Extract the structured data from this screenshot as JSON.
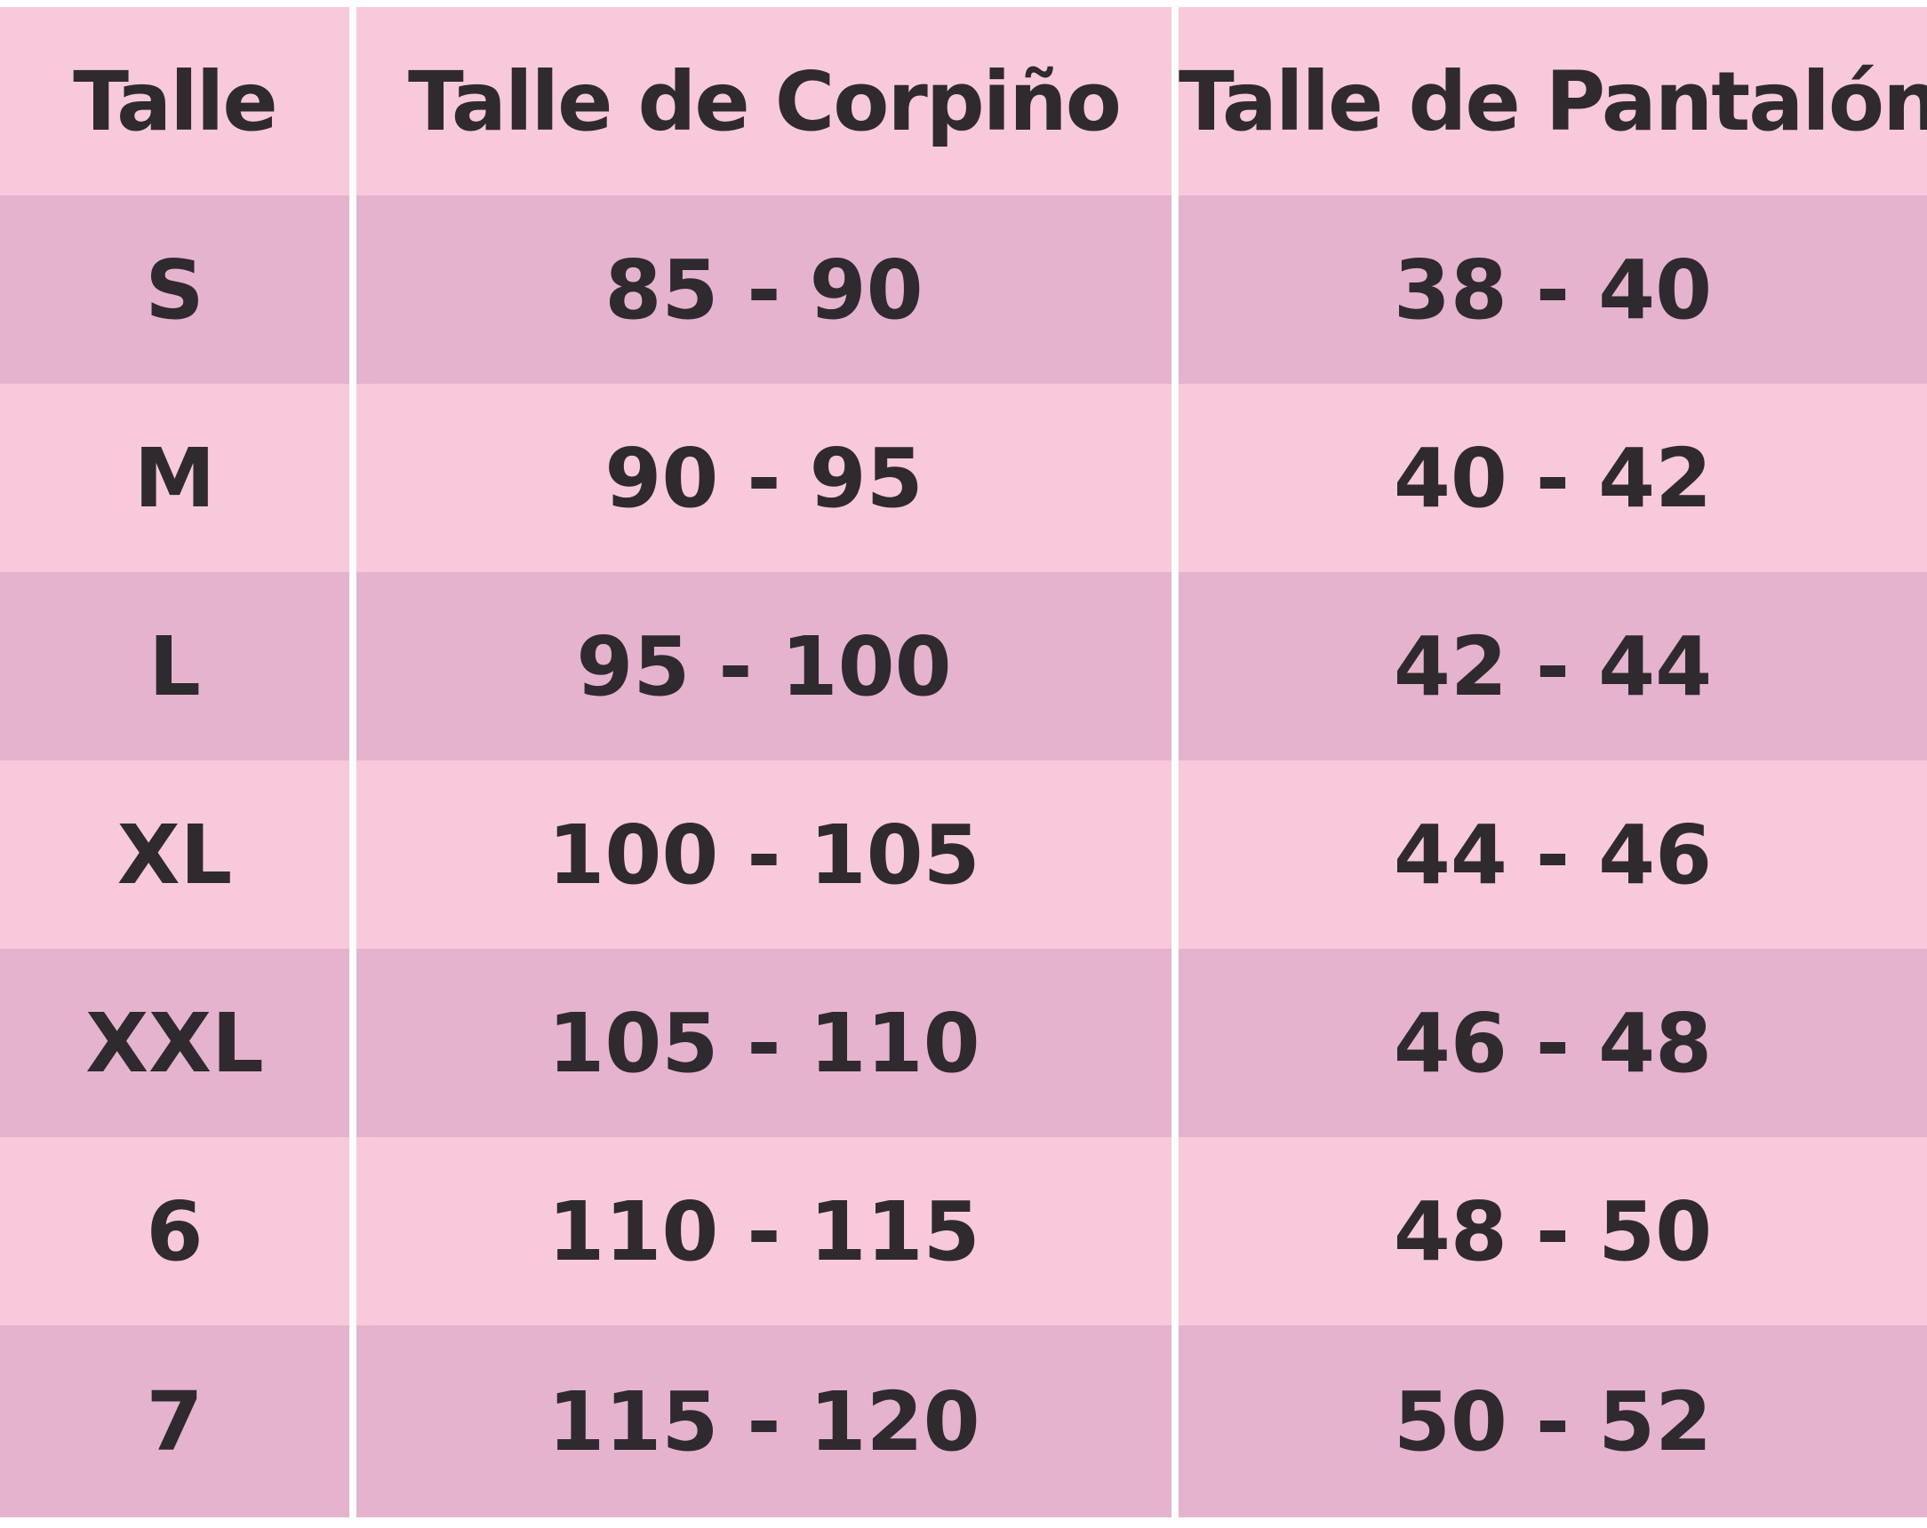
{
  "table": {
    "headers": [
      "Talle",
      "Talle de Corpiño",
      "Talle de Pantalón"
    ],
    "rows": [
      [
        "S",
        "85 - 90",
        "38 - 40"
      ],
      [
        "M",
        "90 - 95",
        "40 - 42"
      ],
      [
        "L",
        "95 - 100",
        "42 - 44"
      ],
      [
        "XL",
        "100 - 105",
        "44 - 46"
      ],
      [
        "XXL",
        "105 - 110",
        "46 - 48"
      ],
      [
        "6",
        "110 - 115",
        "48 - 50"
      ],
      [
        "7",
        "115 - 120",
        "50 - 52"
      ]
    ]
  },
  "colors": {
    "row_light": "#f7c9db",
    "row_dark": "#e5b3ce",
    "text": "#2e2a2d",
    "divider": "#ffffff"
  }
}
